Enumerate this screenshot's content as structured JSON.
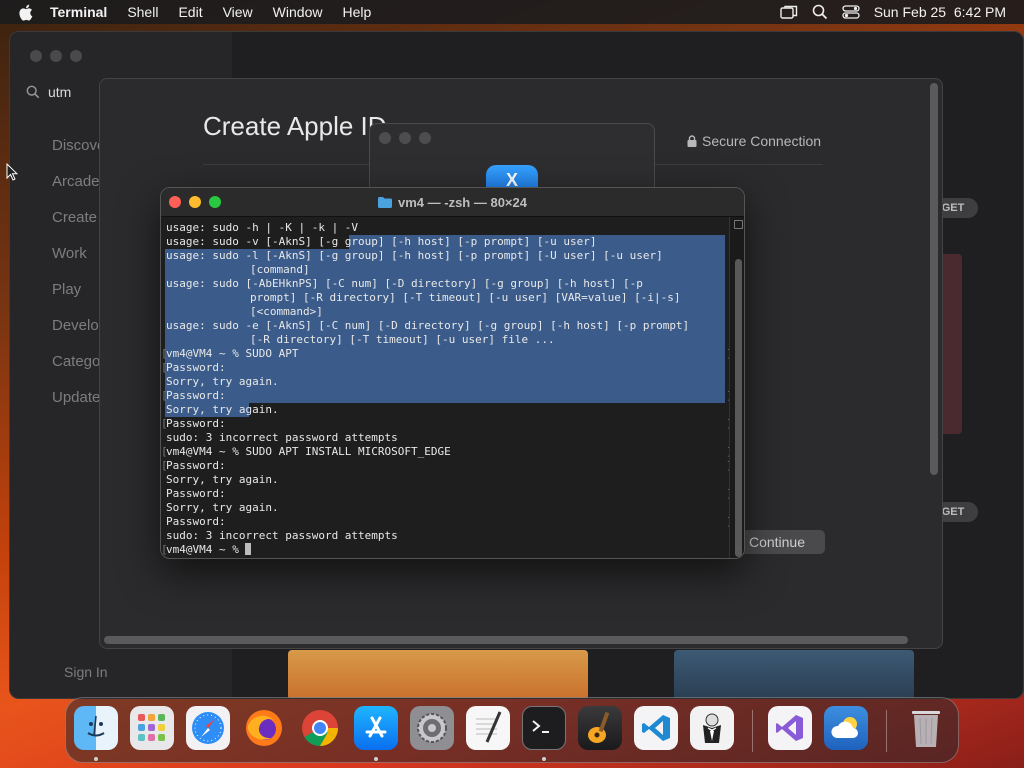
{
  "menubar": {
    "app_name": "Terminal",
    "items": [
      "Shell",
      "Edit",
      "View",
      "Window",
      "Help"
    ],
    "datetime": "Sun Feb 25  6:42 PM",
    "status_icons": [
      "screen-mirroring-icon",
      "search-icon",
      "control-center-icon"
    ]
  },
  "appstore": {
    "search_value": "utm",
    "nav_items": [
      "Discover",
      "Arcade",
      "Create",
      "Work",
      "Play",
      "Develop",
      "Categories",
      "Updates"
    ],
    "sign_in": "Sign In",
    "get_label": "GET"
  },
  "sheet": {
    "title": "Create Apple ID",
    "secure": "Secure Connection",
    "continue": "Continue"
  },
  "terminal": {
    "title": "vm4 — -zsh — 80×24",
    "lines": [
      "usage: sudo -h | -K | -k | -V",
      "usage: sudo -v [-AknS] [-g group] [-h host] [-p prompt] [-u user]",
      "usage: sudo -l [-AknS] [-g group] [-h host] [-p prompt] [-U user] [-u user]",
      "[command]",
      "usage: sudo [-AbEHknPS] [-C num] [-D directory] [-g group] [-h host] [-p",
      "prompt] [-R directory] [-T timeout] [-u user] [VAR=value] [-i|-s]",
      "[<command>]",
      "usage: sudo -e [-AknS] [-C num] [-D directory] [-g group] [-h host] [-p prompt]",
      "[-R directory] [-T timeout] [-u user] file ...",
      "vm4@VM4 ~ % SUDO APT",
      "Password:",
      "Sorry, try again.",
      "Password:",
      "Sorry, try again.",
      "Password:",
      "sudo: 3 incorrect password attempts",
      "vm4@VM4 ~ % SUDO APT INSTALL MICROSOFT_EDGE",
      "Password:",
      "Sorry, try again.",
      "Password:",
      "Sorry, try again.",
      "Password:",
      "sudo: 3 incorrect password attempts",
      "vm4@VM4 ~ % "
    ]
  },
  "dock": {
    "apps": [
      "finder-icon",
      "launchpad-icon",
      "safari-icon",
      "firefox-icon",
      "chrome-icon",
      "app-store-icon",
      "system-settings-icon",
      "textedit-icon",
      "terminal-icon",
      "garageband-icon",
      "vscode-icon",
      "bartender-icon",
      "visual-studio-icon",
      "weather-icon",
      "trash-icon"
    ]
  }
}
